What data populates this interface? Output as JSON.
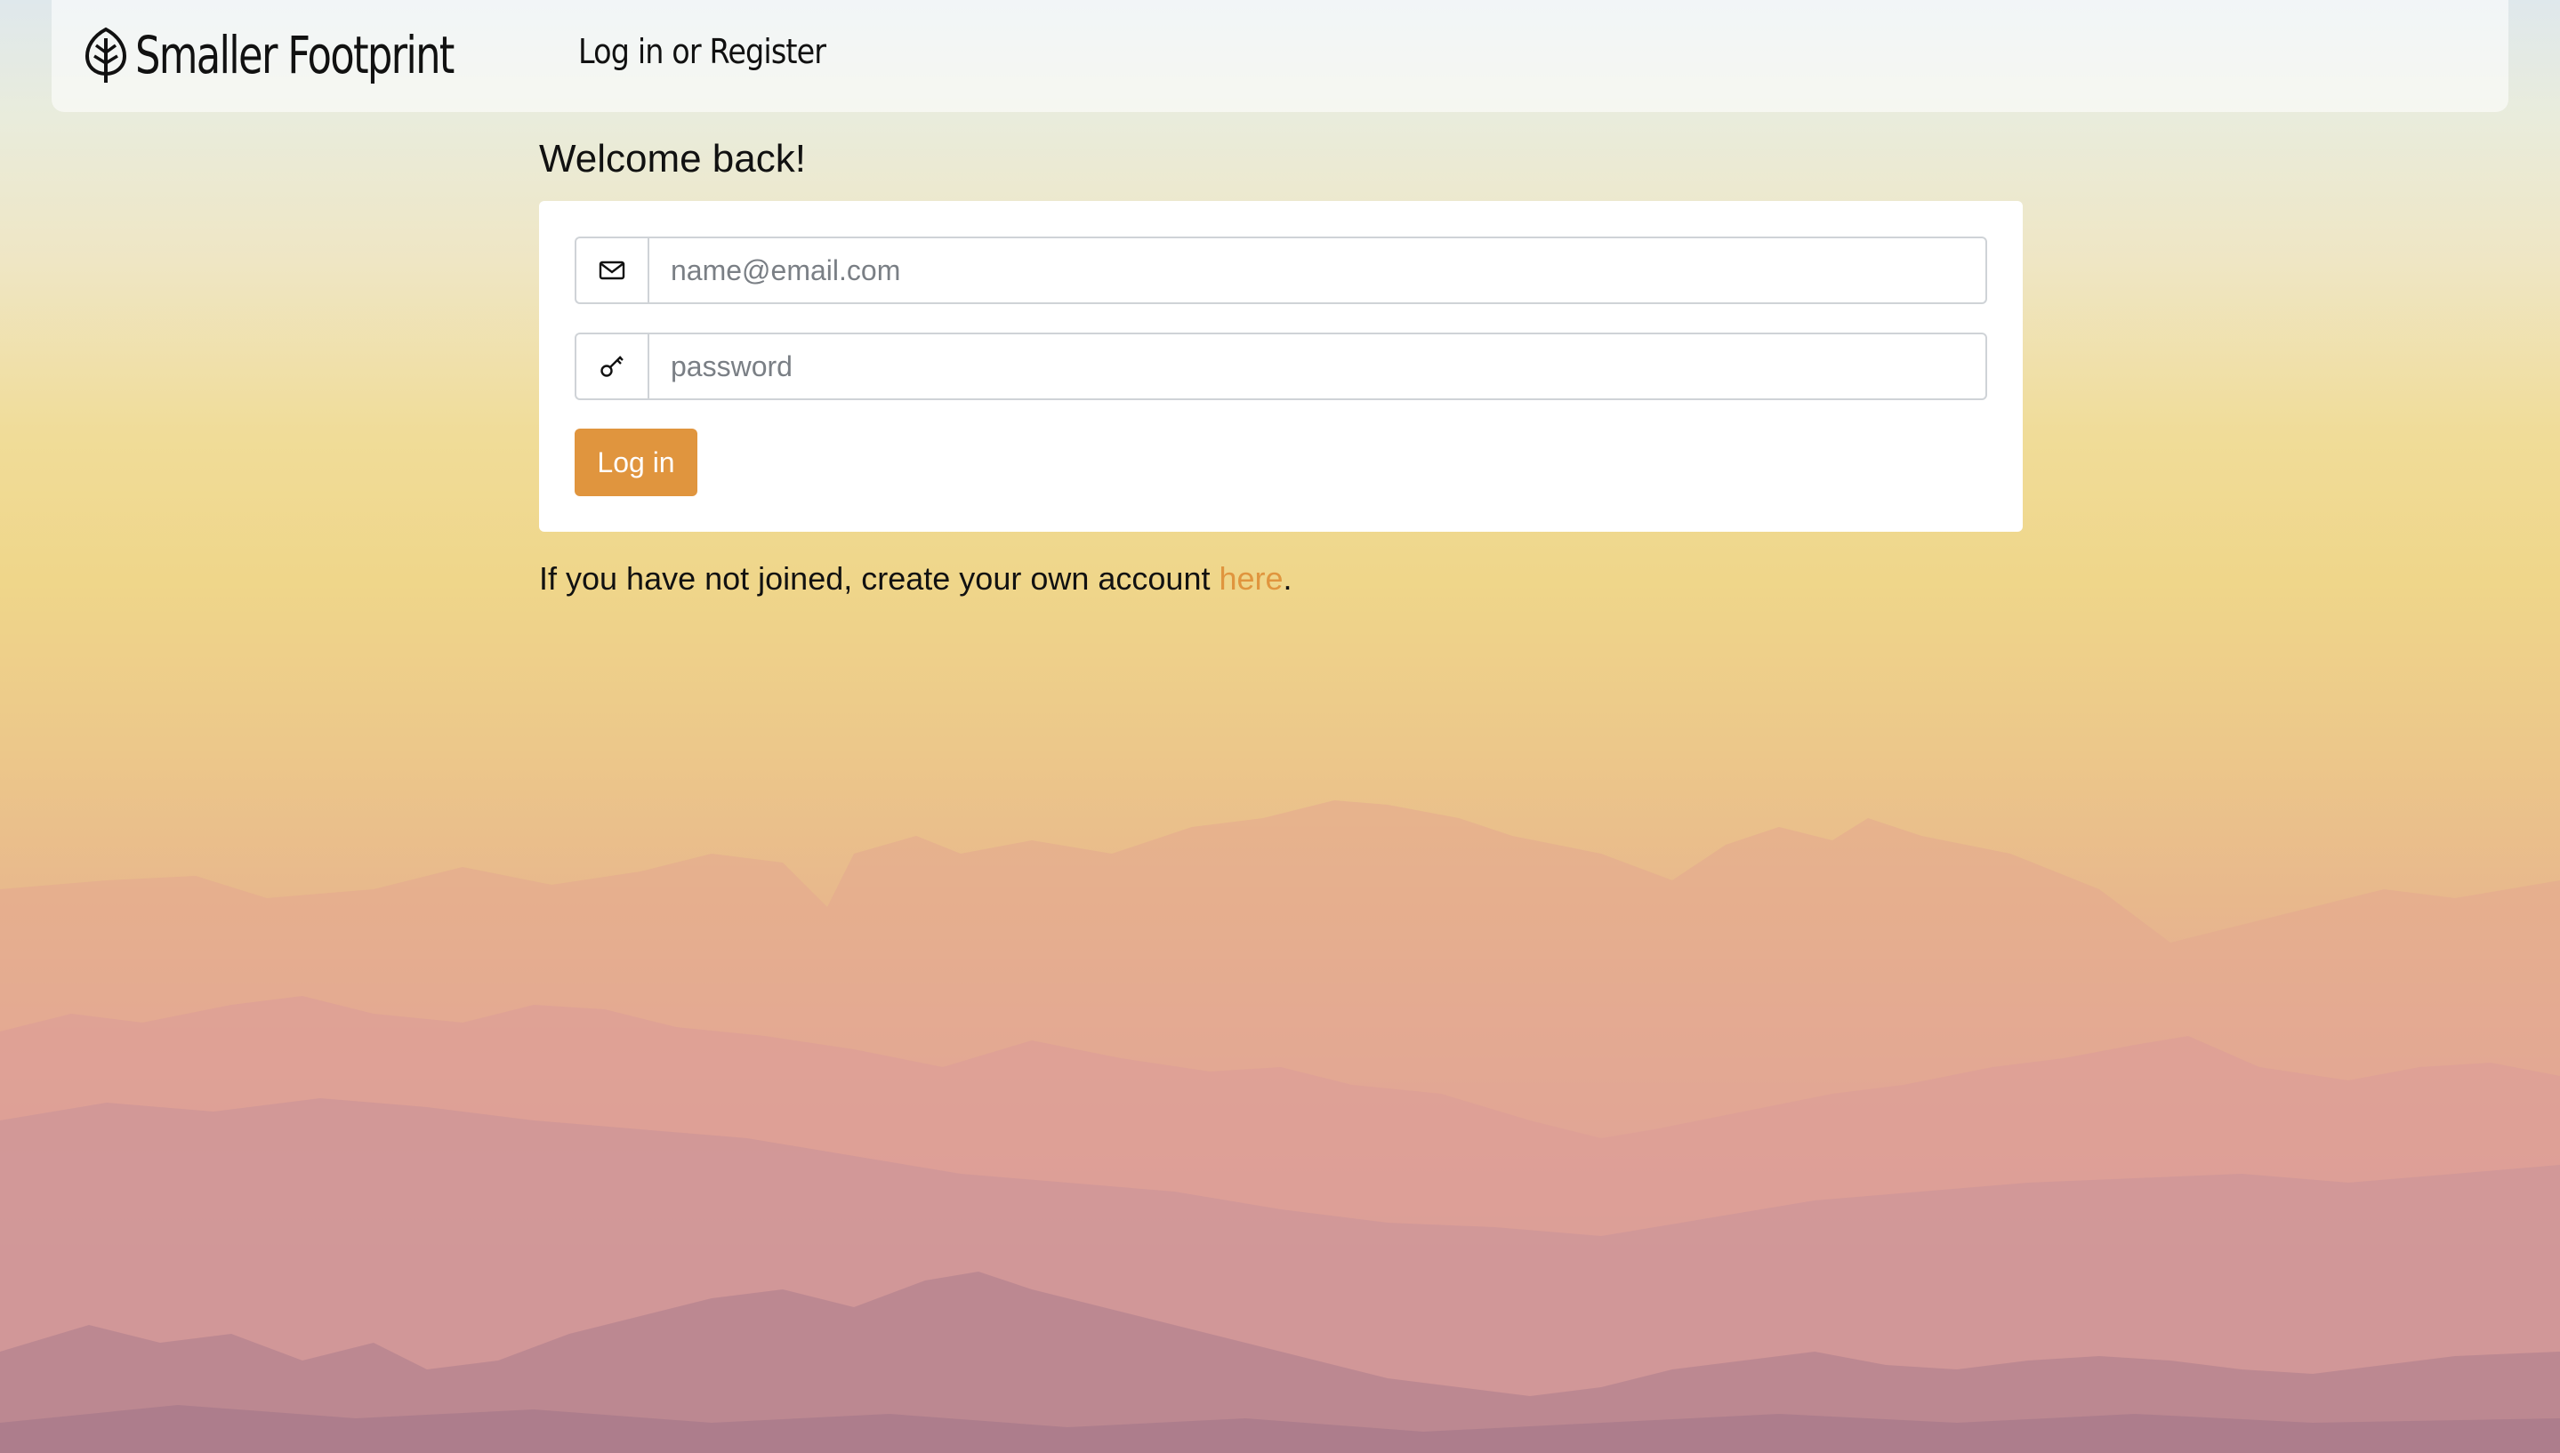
{
  "nav": {
    "brand": "Smaller Footprint",
    "login_register": "Log in or Register"
  },
  "page": {
    "heading": "Welcome back!"
  },
  "form": {
    "email_placeholder": "name@email.com",
    "password_placeholder": "password",
    "submit_label": "Log in"
  },
  "register": {
    "prefix": "If you have not joined, create your own account ",
    "link_label": "here",
    "suffix": "."
  },
  "icons": {
    "brand": "leaf-icon",
    "email": "envelope-icon",
    "password": "key-icon"
  },
  "colors": {
    "accent": "#e0953e",
    "text": "#111111",
    "input_border": "#cfd3d7"
  }
}
